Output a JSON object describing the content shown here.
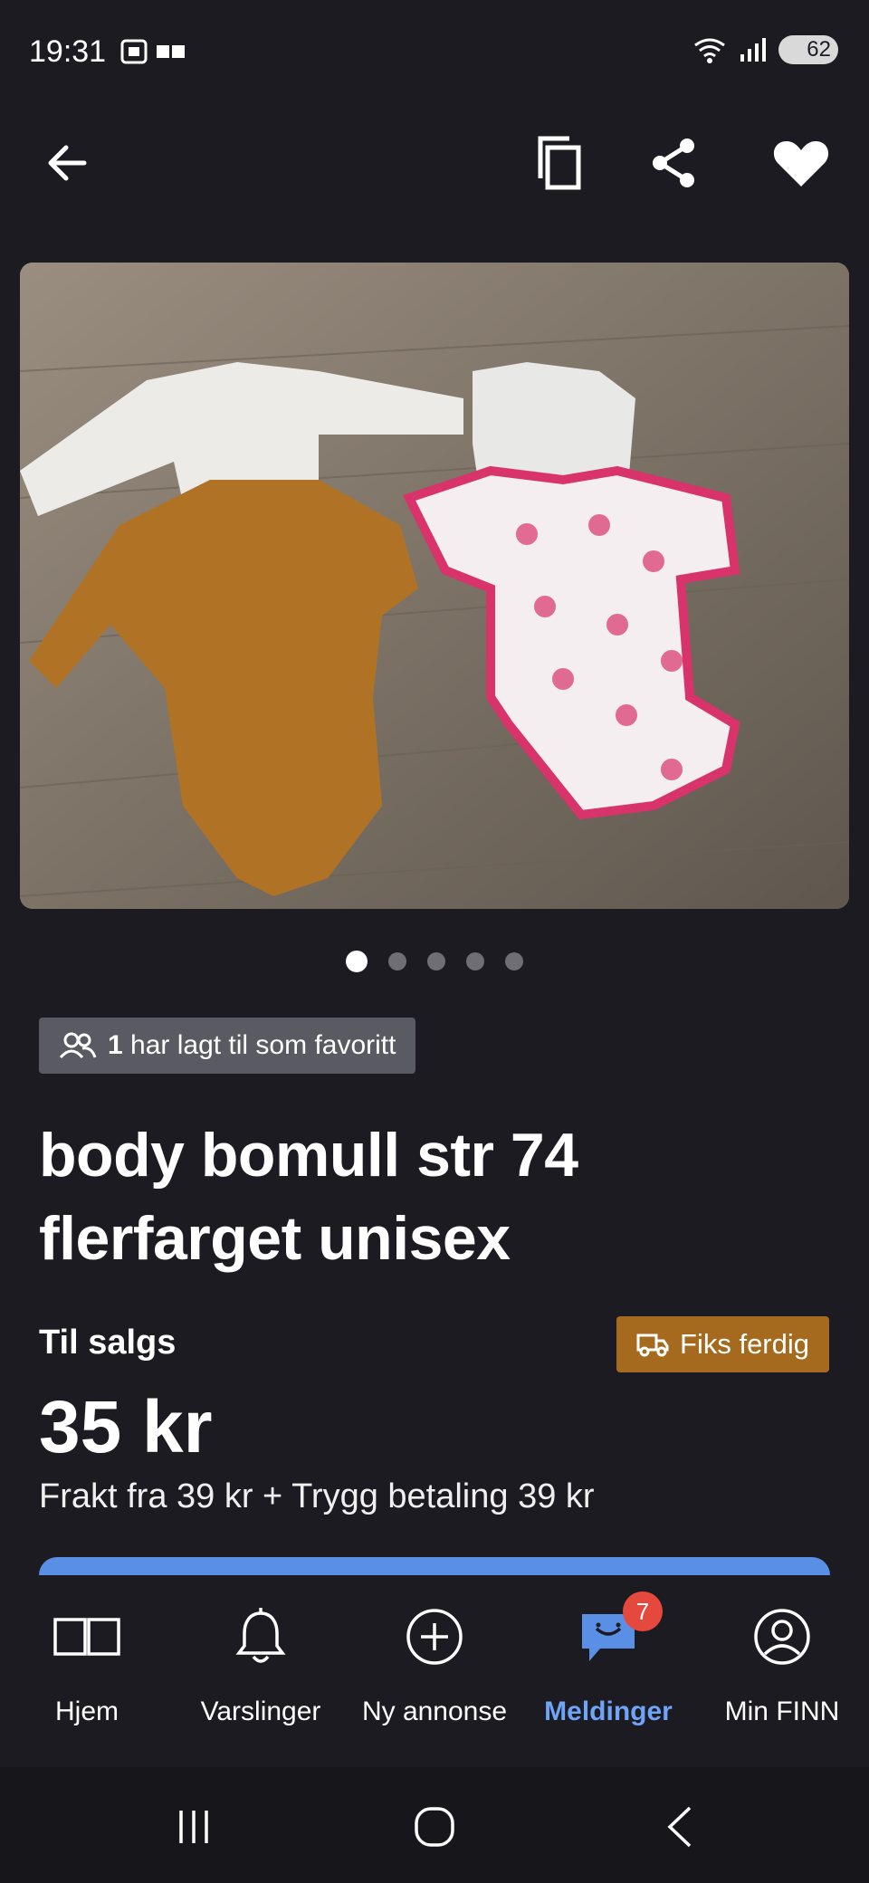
{
  "status_bar": {
    "time": "19:31",
    "battery": "62"
  },
  "listing": {
    "image_count": 5,
    "active_image_index": 0,
    "favorites_count": "1",
    "favorites_text": "har lagt til som favoritt",
    "title": "body bomull str 74 flerfarget unisex",
    "status": "Til salgs",
    "badge": "Fiks ferdig",
    "price": "35 kr",
    "shipping": "Frakt fra 39 kr + Trygg betaling 39 kr"
  },
  "bottom_nav": {
    "items": [
      {
        "label": "Hjem",
        "icon": "book-icon"
      },
      {
        "label": "Varslinger",
        "icon": "bell-icon"
      },
      {
        "label": "Ny annonse",
        "icon": "plus-circle-icon"
      },
      {
        "label": "Meldinger",
        "icon": "chat-icon",
        "badge": "7",
        "active": true
      },
      {
        "label": "Min FINN",
        "icon": "profile-icon"
      }
    ]
  },
  "colors": {
    "background": "#1b1b21",
    "accent": "#6fa4f7",
    "badge": "#a66a1e",
    "notification": "#e5483c"
  }
}
